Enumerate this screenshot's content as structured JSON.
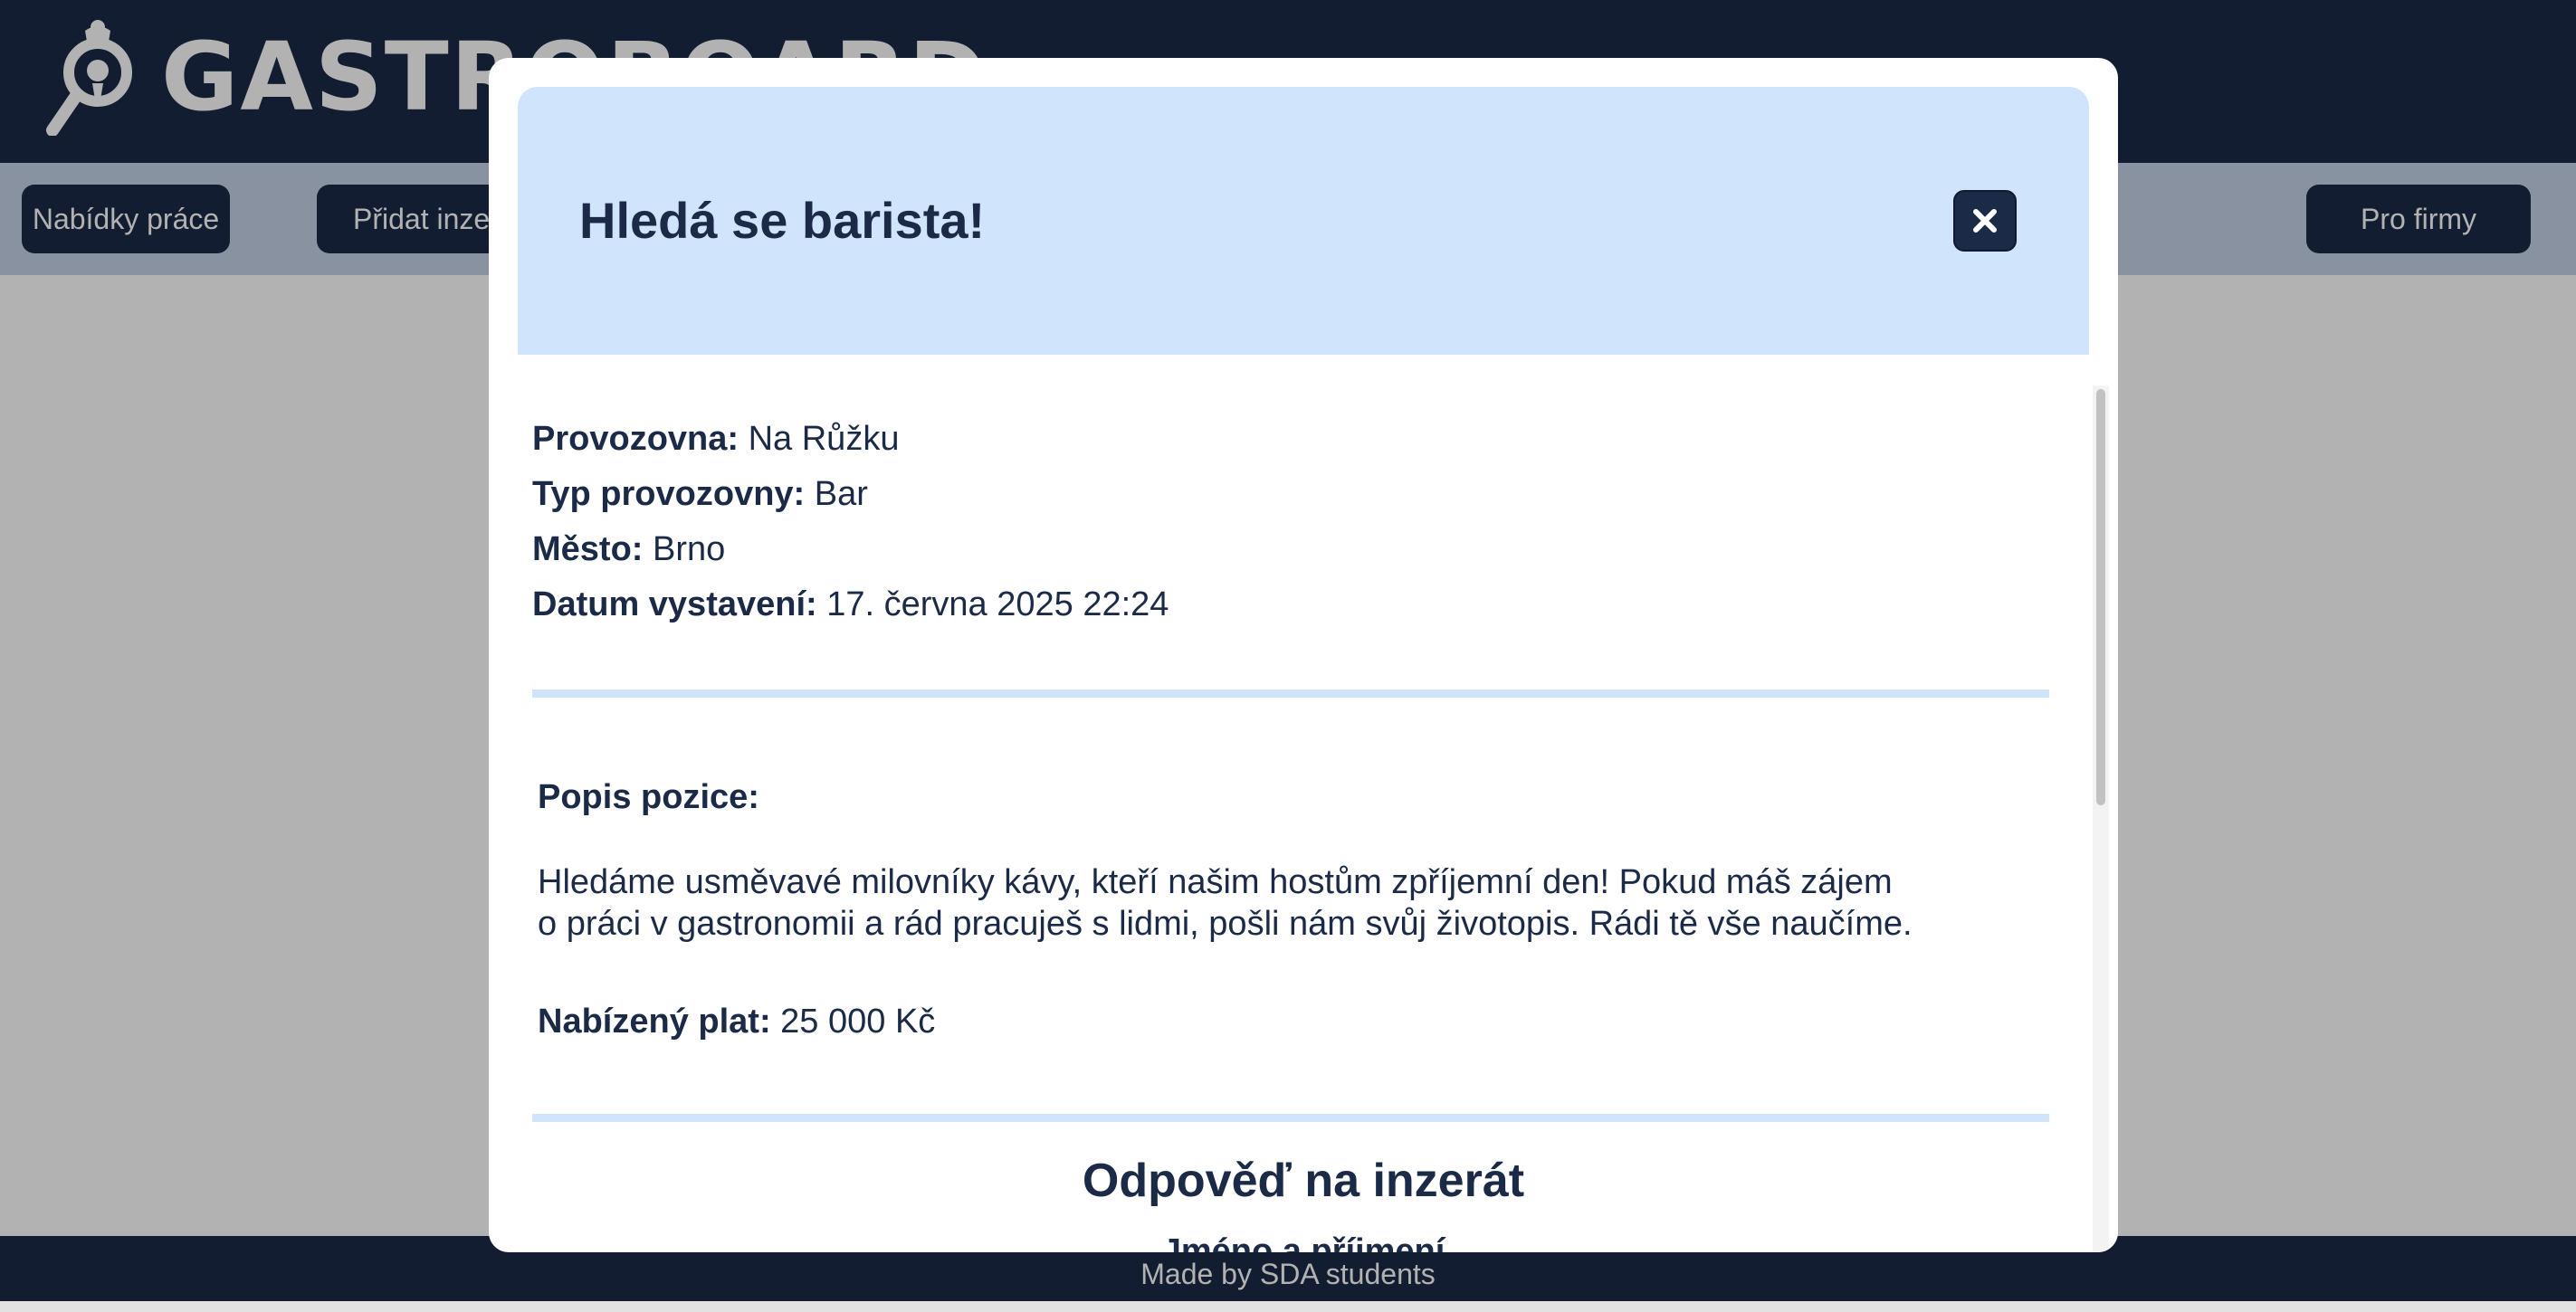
{
  "app": {
    "brand": "GASTROBOARD",
    "nav": {
      "jobs": "Nabídky práce",
      "add": "Přidat inzerát",
      "firms": "Pro firmy"
    },
    "footer": "Made by SDA students"
  },
  "modal": {
    "title": "Hledá se barista!",
    "details": [
      {
        "label": "Provozovna:",
        "value": "Na Růžku"
      },
      {
        "label": "Typ provozovny:",
        "value": "Bar"
      },
      {
        "label": "Město:",
        "value": "Brno"
      },
      {
        "label": "Datum vystavení:",
        "value": "17. června 2025 22:24"
      }
    ],
    "description_label": "Popis pozice:",
    "description_lines": [
      "Hledáme usměvavé milovníky kávy, kteří našim hostům zpříjemní den! Pokud máš zájem",
      "o práci v gastronomii a rád pracuješ s lidmi, pošli nám svůj životopis. Rádi tě vše naučíme."
    ],
    "salary_label": "Nabízený plat:",
    "salary_value": "25 000 Kč",
    "reply_title": "Odpověď na inzerát",
    "reply_subtext": "Jméno a příjmení"
  },
  "colors": {
    "navy": "#1b2a47",
    "light_blue": "#d0e5fb",
    "nav_bar": "#c3d2e5"
  },
  "icons": {
    "logo": "chef-magnifier-icon",
    "close": "close-icon"
  }
}
